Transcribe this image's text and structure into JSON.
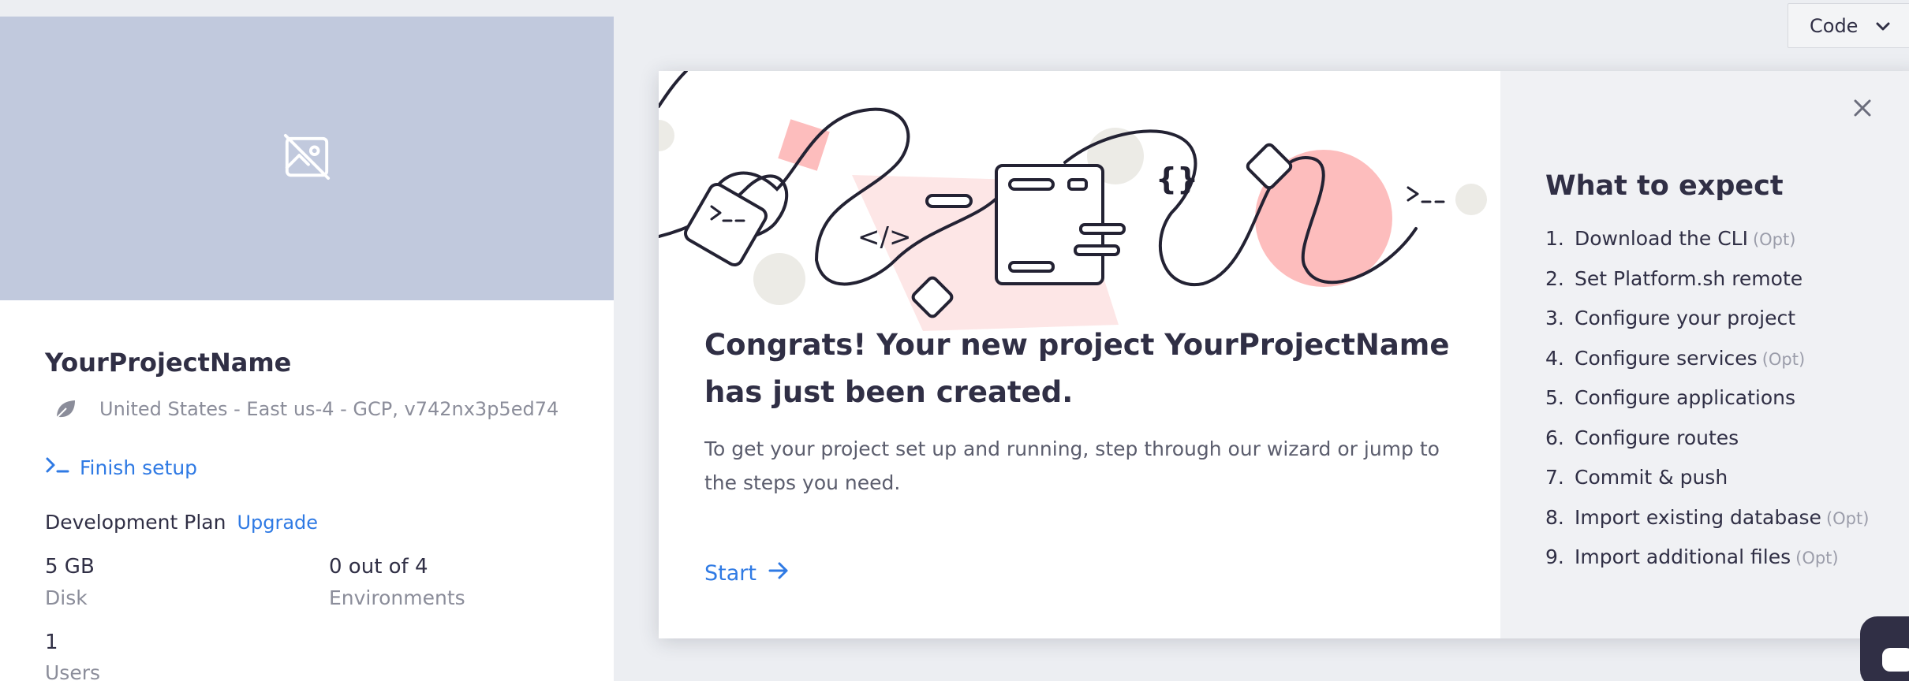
{
  "project": {
    "name": "YourProjectName",
    "region": "United States - East us-4 - GCP, v742nx3p5ed74",
    "finish_setup": "Finish setup",
    "plan_label": "Development Plan",
    "upgrade_label": "Upgrade",
    "disk_value": "5 GB",
    "disk_label": "Disk",
    "environments_value": "0 out of 4",
    "environments_label": "Environments",
    "users_value": "1",
    "users_label": "Users"
  },
  "toolbar": {
    "code_label": "Code"
  },
  "modal": {
    "title": "Congrats! Your new project YourProjectName has just been created.",
    "description": "To get your project set up and running, step through our wizard or jump to the steps you need.",
    "start_label": "Start",
    "side_title": "What to expect",
    "steps": [
      {
        "num": "1.",
        "label": "Download the CLI",
        "opt": "(Opt)"
      },
      {
        "num": "2.",
        "label": "Set Platform.sh remote",
        "opt": ""
      },
      {
        "num": "3.",
        "label": "Configure your project",
        "opt": ""
      },
      {
        "num": "4.",
        "label": "Configure services",
        "opt": "(Opt)"
      },
      {
        "num": "5.",
        "label": "Configure applications",
        "opt": ""
      },
      {
        "num": "6.",
        "label": "Configure routes",
        "opt": ""
      },
      {
        "num": "7.",
        "label": "Commit & push",
        "opt": ""
      },
      {
        "num": "8.",
        "label": "Import existing database",
        "opt": "(Opt)"
      },
      {
        "num": "9.",
        "label": "Import additional files",
        "opt": "(Opt)"
      }
    ]
  },
  "colors": {
    "accent": "#2f7ae4",
    "hero": "#c1c9dd",
    "text": "#302f45",
    "muted": "#8b8d9a",
    "illustration_pink": "#fdbdbd"
  },
  "icons": {
    "hero": "image-off-icon",
    "region": "leaf-icon",
    "finish_setup": "terminal-prompt-icon",
    "code_dropdown": "chevron-down-icon",
    "start": "arrow-right-icon",
    "close": "close-icon",
    "chat": "chat-icon"
  }
}
